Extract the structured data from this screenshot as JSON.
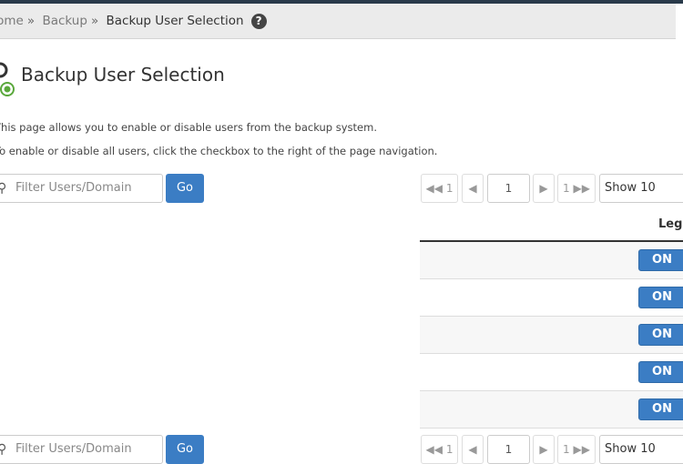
{
  "breadcrumb": {
    "items": [
      "Home",
      "Backup",
      "Backup User Selection"
    ]
  },
  "page": {
    "title": "Backup User Selection",
    "desc1": "This page allows you to enable or disable users from the backup system.",
    "desc2": "To enable or disable all users, click the checkbox to the right of the page navigation."
  },
  "toolbar": {
    "filter_placeholder": "Filter Users/Domain",
    "go_label": "Go",
    "first_label": "◀◀ 1",
    "prev_label": "◀",
    "page_value": "1",
    "next_label": "▶",
    "last_label": "1 ▶▶",
    "show_label": "Show 10"
  },
  "table": {
    "header_legacy": "Lega",
    "rows": [
      {
        "toggle": "ON"
      },
      {
        "toggle": "ON"
      },
      {
        "toggle": "ON"
      },
      {
        "toggle": "ON"
      },
      {
        "toggle": "ON"
      }
    ]
  },
  "colors": {
    "primary": "#3b7dc4",
    "topbar": "#293a4a"
  }
}
